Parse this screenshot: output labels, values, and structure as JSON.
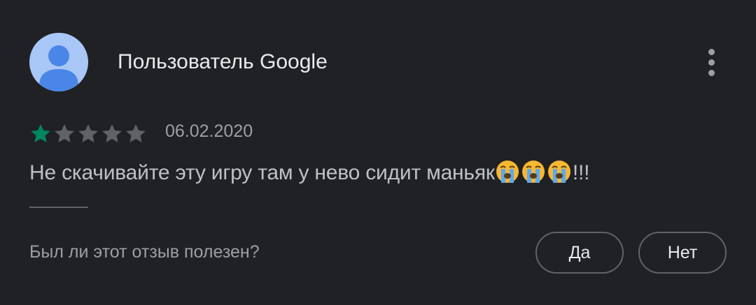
{
  "review": {
    "author": "Пользователь Google",
    "rating": 1,
    "max_rating": 5,
    "date": "06.02.2020",
    "text": "Не скачивайте эту игру там у нево сидит маньяк",
    "emoji": [
      "loudly-crying-face",
      "loudly-crying-face",
      "loudly-crying-face"
    ],
    "text_suffix": "!!!"
  },
  "feedback": {
    "question": "Был ли этот отзыв полезен?",
    "yes_label": "Да",
    "no_label": "Нет"
  },
  "icons": {
    "avatar": "person-avatar-icon",
    "menu": "more-vert-icon",
    "star": "star-icon"
  },
  "colors": {
    "background": "#202124",
    "star_filled": "#01875f",
    "star_empty": "#5f6368",
    "avatar_bg": "#a9c7f6",
    "avatar_fg": "#4a86e8"
  }
}
